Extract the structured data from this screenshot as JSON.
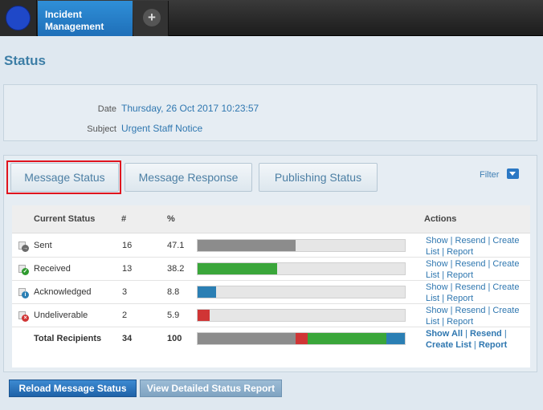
{
  "header": {
    "app_title_line1": "Incident",
    "app_title_line2": "Management",
    "add_symbol": "+"
  },
  "page": {
    "title": "Status"
  },
  "info": {
    "date_label": "Date",
    "date_value": "Thursday, 26 Oct 2017 10:23:57",
    "subject_label": "Subject",
    "subject_value": "Urgent Staff Notice"
  },
  "tabs": [
    {
      "label": "Message Status",
      "active": true
    },
    {
      "label": "Message Response",
      "active": false
    },
    {
      "label": "Publishing Status",
      "active": false
    }
  ],
  "filter": {
    "label": "Filter"
  },
  "table": {
    "headers": {
      "status": "Current Status",
      "count": "#",
      "percent": "%",
      "actions": "Actions"
    },
    "rows": [
      {
        "status": "Sent",
        "count": "16",
        "percent": "47.1",
        "fraction": 0.471,
        "color": "#8c8c8c",
        "badge": "→",
        "badge_color": "#6b6b6b"
      },
      {
        "status": "Received",
        "count": "13",
        "percent": "38.2",
        "fraction": 0.382,
        "color": "#3aa63a",
        "badge": "✓",
        "badge_color": "#2f9b2f"
      },
      {
        "status": "Acknowledged",
        "count": "3",
        "percent": "8.8",
        "fraction": 0.088,
        "color": "#2b7fb4",
        "badge": "i",
        "badge_color": "#2b7fb4"
      },
      {
        "status": "Undeliverable",
        "count": "2",
        "percent": "5.9",
        "fraction": 0.059,
        "color": "#d03535",
        "badge": "×",
        "badge_color": "#d03535"
      }
    ],
    "row_actions": {
      "show": "Show",
      "resend": "Resend",
      "create": "Create",
      "list": "List",
      "report": "Report",
      "sep": "|"
    },
    "total": {
      "status": "Total Recipients",
      "count": "34",
      "percent": "100",
      "segments": [
        {
          "fraction": 0.471,
          "color": "#8c8c8c"
        },
        {
          "fraction": 0.059,
          "color": "#d03535"
        },
        {
          "fraction": 0.382,
          "color": "#3aa63a"
        },
        {
          "fraction": 0.088,
          "color": "#2b7fb4"
        }
      ],
      "actions": {
        "show_all": "Show All",
        "resend": "Resend",
        "create_list": "Create List",
        "report": "Report",
        "sep": "|"
      }
    }
  },
  "buttons": {
    "reload": "Reload Message Status",
    "detailed": "View Detailed Status Report"
  }
}
